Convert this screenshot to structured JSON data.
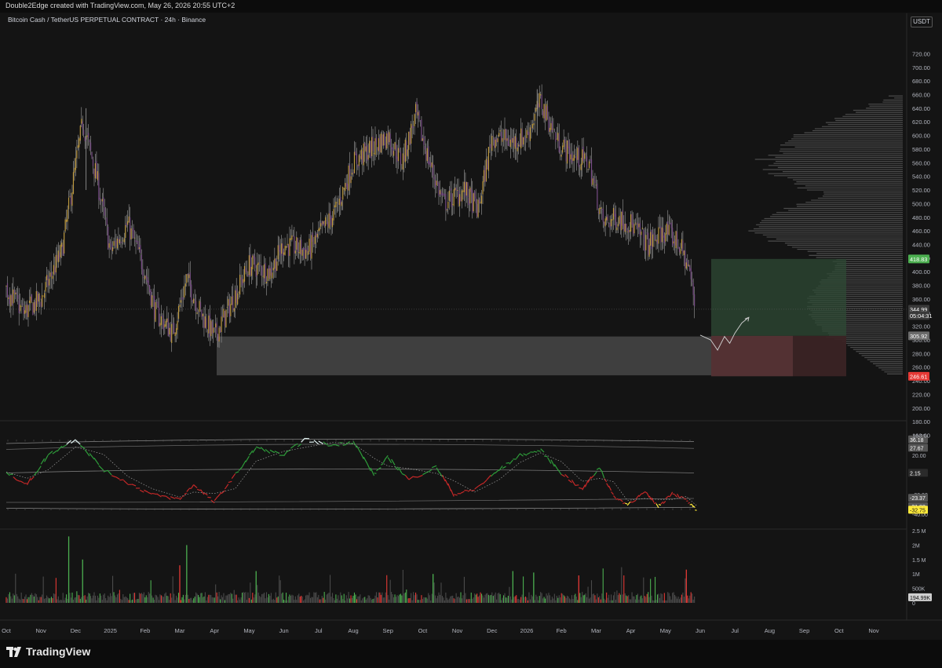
{
  "header": {
    "credit": "Double2Edge created with TradingView.com, May 26, 2026 20:55 UTC+2",
    "title": "Bitcoin Cash / TetherUS PERPETUAL CONTRACT · 24h · Binance",
    "currency": "USDT"
  },
  "footer": {
    "brand": "TradingView"
  },
  "colors": {
    "background": "#141414",
    "bull": "#4caf50",
    "bear": "#e53935",
    "wick": "#9e9e9e",
    "zone": "#474747",
    "target_zone": "#2e4a34",
    "stop_zone": "#5a3436",
    "price_tag_green": "#4caf50",
    "price_tag_red": "#e53935",
    "oscillator_yellow": "#ffeb3b"
  },
  "chart_data": [
    {
      "type": "candlestick",
      "title": "Bitcoin Cash / TetherUS PERPETUAL CONTRACT · 24h · Binance",
      "ylim": [
        140,
        730
      ],
      "y_ticks": [
        "720.00",
        "700.00",
        "680.00",
        "660.00",
        "640.00",
        "620.00",
        "600.00",
        "580.00",
        "560.00",
        "540.00",
        "520.00",
        "500.00",
        "480.00",
        "460.00",
        "440.00",
        "420.00",
        "400.00",
        "380.00",
        "360.00",
        "340.00",
        "320.00",
        "300.00",
        "280.00",
        "260.00",
        "240.00",
        "220.00",
        "200.00",
        "180.00",
        "160.00"
      ],
      "x_ticks": [
        "Oct",
        "Nov",
        "Dec",
        "2025",
        "Feb",
        "Mar",
        "Apr",
        "May",
        "Jun",
        "Jul",
        "Aug",
        "Sep",
        "Oct",
        "Nov",
        "Dec",
        "2026",
        "Feb",
        "Mar",
        "Apr",
        "May",
        "Jun",
        "Jul",
        "Aug",
        "Sep",
        "Oct",
        "Nov"
      ],
      "key_points": [
        {
          "month": 0,
          "price": 375
        },
        {
          "month": 0.5,
          "price": 340
        },
        {
          "month": 1,
          "price": 360
        },
        {
          "month": 1.6,
          "price": 430
        },
        {
          "month": 2.2,
          "price": 620
        },
        {
          "month": 2.6,
          "price": 540
        },
        {
          "month": 3,
          "price": 430
        },
        {
          "month": 3.5,
          "price": 470
        },
        {
          "month": 4,
          "price": 400
        },
        {
          "month": 4.3,
          "price": 340
        },
        {
          "month": 4.8,
          "price": 310
        },
        {
          "month": 5.2,
          "price": 390
        },
        {
          "month": 5.6,
          "price": 340
        },
        {
          "month": 6,
          "price": 305
        },
        {
          "month": 6.4,
          "price": 345
        },
        {
          "month": 7,
          "price": 410
        },
        {
          "month": 7.6,
          "price": 400
        },
        {
          "month": 8,
          "price": 440
        },
        {
          "month": 8.7,
          "price": 430
        },
        {
          "month": 9.5,
          "price": 490
        },
        {
          "month": 10,
          "price": 560
        },
        {
          "month": 10.5,
          "price": 580
        },
        {
          "month": 11,
          "price": 600
        },
        {
          "month": 11.4,
          "price": 560
        },
        {
          "month": 11.8,
          "price": 630
        },
        {
          "month": 12.2,
          "price": 560
        },
        {
          "month": 12.6,
          "price": 500
        },
        {
          "month": 13.2,
          "price": 520
        },
        {
          "month": 13.6,
          "price": 490
        },
        {
          "month": 14,
          "price": 600
        },
        {
          "month": 14.6,
          "price": 590
        },
        {
          "month": 15,
          "price": 600
        },
        {
          "month": 15.4,
          "price": 650
        },
        {
          "month": 15.9,
          "price": 590
        },
        {
          "month": 16.3,
          "price": 570
        },
        {
          "month": 16.8,
          "price": 560
        },
        {
          "month": 17.2,
          "price": 470
        },
        {
          "month": 17.6,
          "price": 480
        },
        {
          "month": 18,
          "price": 470
        },
        {
          "month": 18.5,
          "price": 440
        },
        {
          "month": 19,
          "price": 460
        },
        {
          "month": 19.4,
          "price": 440
        },
        {
          "month": 19.7,
          "price": 400
        },
        {
          "month": 19.85,
          "price": 345
        }
      ],
      "price_labels": [
        {
          "value": "418.83",
          "price": 418.83,
          "color": "#4caf50"
        },
        {
          "value": "344.99",
          "price": 344.99,
          "color": "#3a3a3a"
        },
        {
          "value": "05:04:31",
          "price": 335.8,
          "color": "#3a3a3a"
        },
        {
          "value": "305.92",
          "price": 305.92,
          "color": "#6b6b6b"
        },
        {
          "value": "246.61",
          "price": 246.61,
          "color": "#e53935"
        }
      ],
      "support_zone": {
        "from": 248,
        "to": 305
      },
      "position": {
        "entry": 305.92,
        "target": 418.83,
        "stop": 246.61
      },
      "projection": [
        {
          "month": 20.0,
          "price": 307
        },
        {
          "month": 20.3,
          "price": 300
        },
        {
          "month": 20.5,
          "price": 285
        },
        {
          "month": 20.7,
          "price": 305
        },
        {
          "month": 20.85,
          "price": 295
        },
        {
          "month": 21.0,
          "price": 310
        },
        {
          "month": 21.2,
          "price": 325
        },
        {
          "month": 21.4,
          "price": 333
        }
      ],
      "grid": false
    },
    {
      "type": "line",
      "name": "oscillator",
      "ylim": [
        -40,
        40
      ],
      "y_ticks": [
        "40.00",
        "20.00",
        "-20.00",
        "-40.00"
      ],
      "values_labels": [
        "36.18",
        "27.67",
        "2.15",
        "-23.37",
        "-31.88",
        "-32.75"
      ],
      "series_points": [
        {
          "month": 0,
          "v": 3
        },
        {
          "month": 0.6,
          "v": -10
        },
        {
          "month": 1.2,
          "v": 20
        },
        {
          "month": 2,
          "v": 37
        },
        {
          "month": 2.8,
          "v": 5
        },
        {
          "month": 3.5,
          "v": -8
        },
        {
          "month": 4.2,
          "v": -20
        },
        {
          "month": 5,
          "v": -25
        },
        {
          "month": 5.4,
          "v": -10
        },
        {
          "month": 6,
          "v": -28
        },
        {
          "month": 6.6,
          "v": 0
        },
        {
          "month": 7.2,
          "v": 28
        },
        {
          "month": 8,
          "v": 20
        },
        {
          "month": 8.6,
          "v": 36
        },
        {
          "month": 9.4,
          "v": 30
        },
        {
          "month": 10,
          "v": 34
        },
        {
          "month": 10.6,
          "v": 0
        },
        {
          "month": 11,
          "v": 18
        },
        {
          "month": 11.6,
          "v": -5
        },
        {
          "month": 12.4,
          "v": 8
        },
        {
          "month": 12.9,
          "v": -20
        },
        {
          "month": 13.5,
          "v": -15
        },
        {
          "month": 14.2,
          "v": 5
        },
        {
          "month": 14.8,
          "v": 20
        },
        {
          "month": 15.4,
          "v": 25
        },
        {
          "month": 16,
          "v": 2
        },
        {
          "month": 16.6,
          "v": -15
        },
        {
          "month": 17.1,
          "v": 8
        },
        {
          "month": 17.5,
          "v": -22
        },
        {
          "month": 17.9,
          "v": -30
        },
        {
          "month": 18.4,
          "v": -18
        },
        {
          "month": 18.8,
          "v": -32
        },
        {
          "month": 19.2,
          "v": -18
        },
        {
          "month": 19.6,
          "v": -26
        },
        {
          "month": 19.9,
          "v": -37
        }
      ]
    },
    {
      "type": "bar",
      "name": "volume",
      "ylim": [
        0,
        2500000
      ],
      "y_ticks": [
        "2.5 M",
        "2M",
        "1.5 M",
        "1M",
        "500K",
        "0"
      ],
      "last_value_label": "194.99K"
    }
  ]
}
